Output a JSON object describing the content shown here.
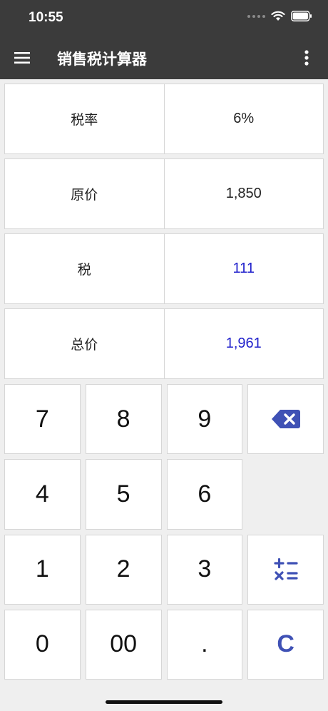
{
  "status": {
    "time": "10:55"
  },
  "appbar": {
    "title": "销售税计算器"
  },
  "rows": [
    {
      "label": "税率",
      "value": "6%",
      "result": false
    },
    {
      "label": "原价",
      "value": "1,850",
      "result": false
    },
    {
      "label": "税",
      "value": "111",
      "result": true
    },
    {
      "label": "总价",
      "value": "1,961",
      "result": true
    }
  ],
  "keys": {
    "k7": "7",
    "k8": "8",
    "k9": "9",
    "k4": "4",
    "k5": "5",
    "k6": "6",
    "k1": "1",
    "k2": "2",
    "k3": "3",
    "k0": "0",
    "k00": "00",
    "kdot": ".",
    "kclear": "C"
  },
  "colors": {
    "appbar": "#3b3b3b",
    "accent": "#3f51b5",
    "result": "#2222cc"
  },
  "icons": {
    "menu": "hamburger-icon",
    "more": "more-vertical-icon",
    "backspace": "backspace-icon",
    "operators": "operators-icon"
  }
}
